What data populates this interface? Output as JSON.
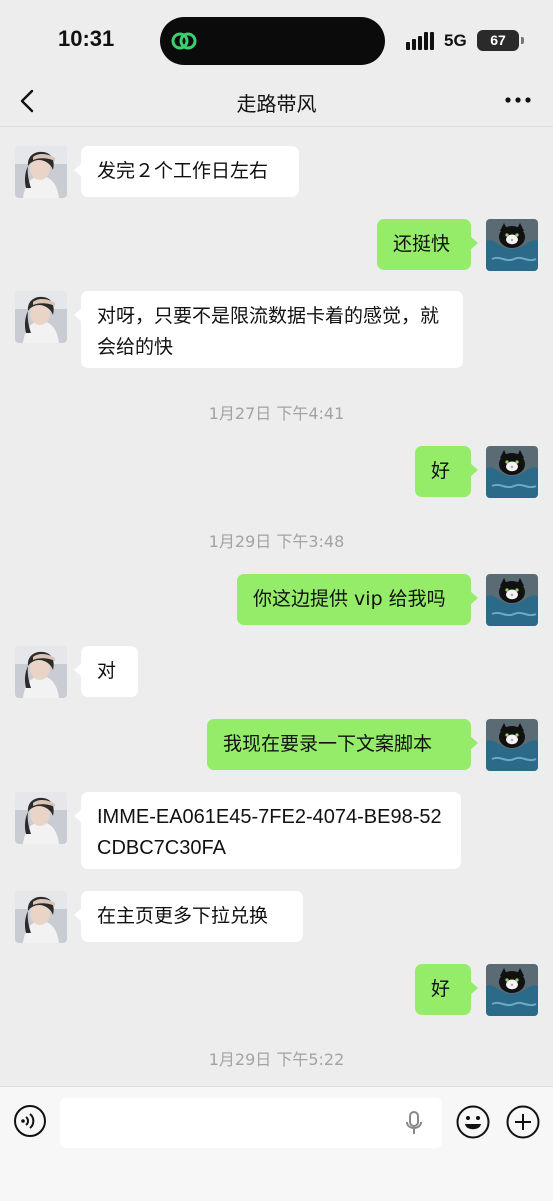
{
  "status_bar": {
    "time": "10:31",
    "network": "5G",
    "battery": "67"
  },
  "header": {
    "title": "走路带风"
  },
  "messages": [
    {
      "side": "left",
      "text": "发完２个工作日左右"
    },
    {
      "side": "right",
      "text": "还挺快"
    },
    {
      "side": "left",
      "text": "对呀，只要不是限流数据卡着的感觉，就会给的快"
    },
    {
      "type": "time",
      "text": "1月27日 下午4:41"
    },
    {
      "side": "right",
      "text": "好"
    },
    {
      "type": "time",
      "text": "1月29日 下午3:48"
    },
    {
      "side": "right",
      "text": "你这边提供 vip 给我吗"
    },
    {
      "side": "left",
      "text": "对"
    },
    {
      "side": "right",
      "text": "我现在要录一下文案脚本"
    },
    {
      "side": "left",
      "text": "IMME-EA061E45-7FE2-4074-BE98-52CDBC7C30FA"
    },
    {
      "side": "left",
      "text": "在主页更多下拉兑换"
    },
    {
      "side": "right",
      "text": "好"
    },
    {
      "type": "time",
      "text": "1月29日 下午5:22"
    }
  ],
  "icons": {
    "back": "chevron-left-icon",
    "more": "more-dots-icon",
    "voice": "voice-icon",
    "mic": "mic-icon",
    "emoji": "emoji-icon",
    "plus": "plus-icon"
  },
  "colors": {
    "sent_bubble": "#95ec69",
    "received_bubble": "#ffffff",
    "background": "#ededed"
  }
}
